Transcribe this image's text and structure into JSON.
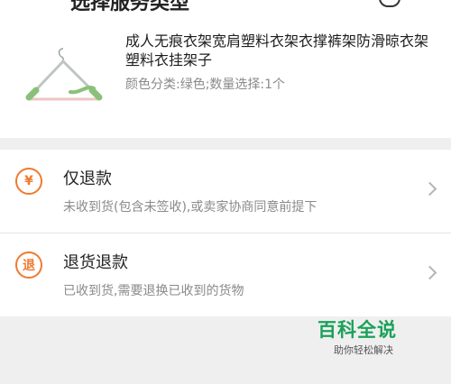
{
  "header": {
    "title": "选择服务类型"
  },
  "product": {
    "name": "成人无痕衣架宽肩塑料衣架衣撑裤架防滑晾衣架塑料衣挂架子",
    "spec": "颜色分类:绿色;数量选择:1个"
  },
  "options": [
    {
      "label": "仅退款",
      "desc": "未收到货(包含未签收),或卖家协商同意前提下",
      "icon_char": "¥",
      "icon": "yen-circle-icon"
    },
    {
      "label": "退货退款",
      "desc": "已收到货,需要退换已收到的货物",
      "icon_char": "退",
      "icon": "return-circle-icon"
    }
  ],
  "watermark": {
    "title": "百科全说",
    "subtitle": "助你轻松解决"
  },
  "colors": {
    "accent": "#f07a30",
    "watermark": "#1aa159",
    "background": "#efefef"
  }
}
